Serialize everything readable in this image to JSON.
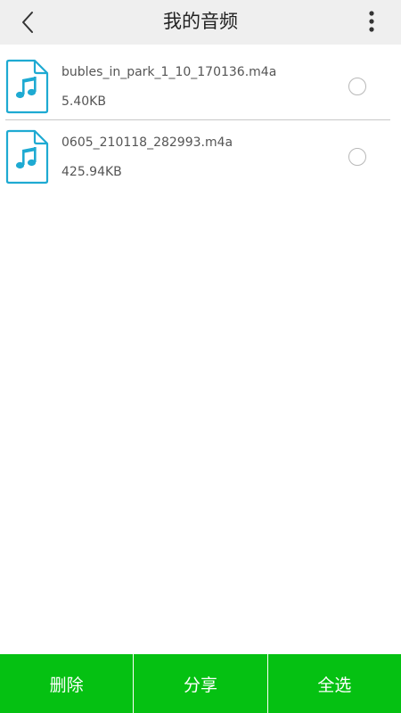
{
  "header": {
    "title": "我的音频",
    "back_icon": "chevron-left-icon",
    "more_icon": "more-vertical-icon"
  },
  "files": [
    {
      "name": "bubles_in_park_1_10_170136.m4a",
      "size": "5.40KB",
      "icon": "audio-file-icon",
      "selected": false
    },
    {
      "name": "0605_210118_282993.m4a",
      "size": "425.94KB",
      "icon": "audio-file-icon",
      "selected": false
    }
  ],
  "actions": {
    "delete_label": "删除",
    "share_label": "分享",
    "select_all_label": "全选"
  },
  "colors": {
    "accent_green": "#05c112",
    "icon_cyan": "#1eaad2",
    "header_bg": "#efefef"
  }
}
